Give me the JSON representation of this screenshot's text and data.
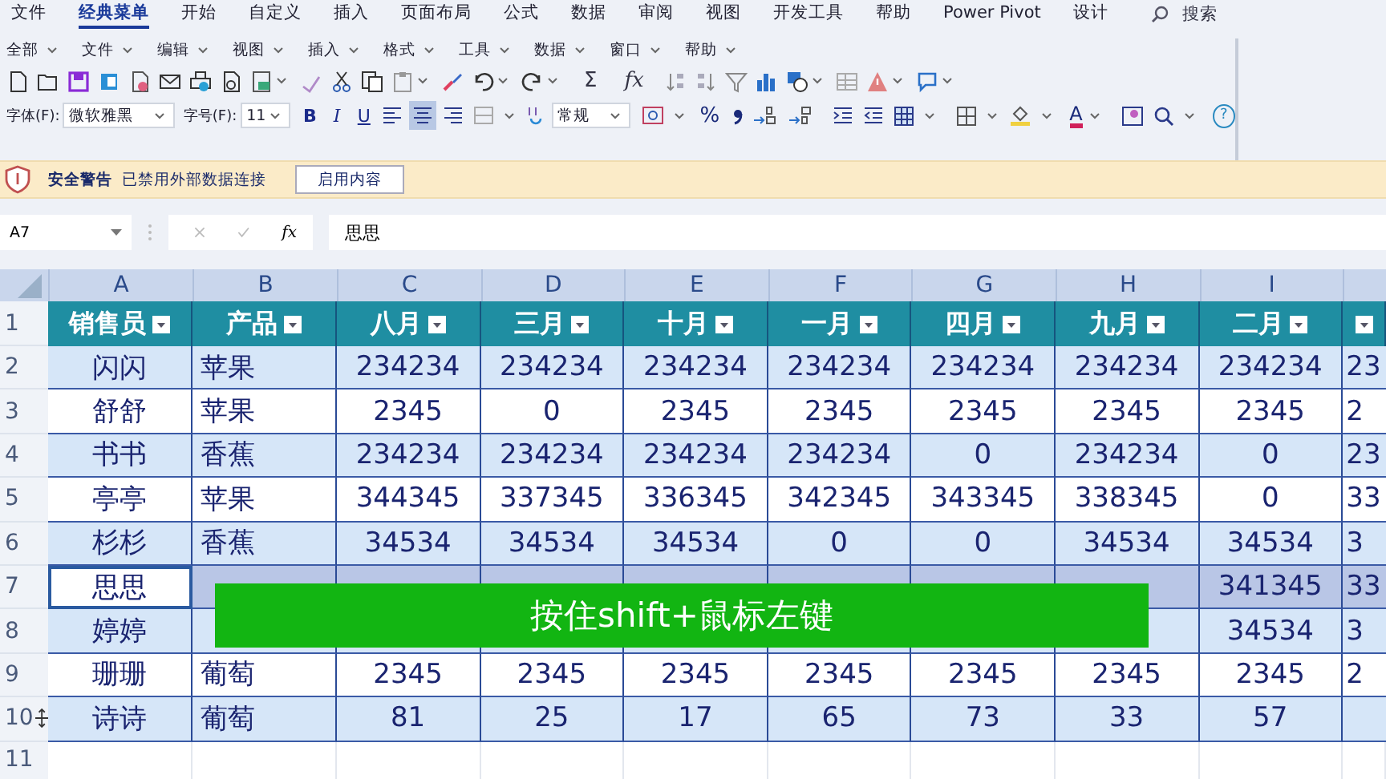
{
  "menu_tabs": [
    {
      "label": "文件",
      "selected": false
    },
    {
      "label": "经典菜单",
      "selected": true
    },
    {
      "label": "开始",
      "selected": false
    },
    {
      "label": "自定义",
      "selected": false
    },
    {
      "label": "插入",
      "selected": false
    },
    {
      "label": "页面布局",
      "selected": false
    },
    {
      "label": "公式",
      "selected": false
    },
    {
      "label": "数据",
      "selected": false
    },
    {
      "label": "审阅",
      "selected": false
    },
    {
      "label": "视图",
      "selected": false
    },
    {
      "label": "开发工具",
      "selected": false
    },
    {
      "label": "帮助",
      "selected": false
    },
    {
      "label": "Power Pivot",
      "selected": false
    },
    {
      "label": "设计",
      "selected": false
    }
  ],
  "search": {
    "label": "搜索"
  },
  "classic_menus": [
    "全部",
    "文件",
    "编辑",
    "视图",
    "插入",
    "格式",
    "工具",
    "数据",
    "窗口",
    "帮助"
  ],
  "toolbar": {
    "sum": "Σ",
    "fx": "fx"
  },
  "format_bar": {
    "font_label": "字体(F):",
    "font": "微软雅黑",
    "size_label": "字号(F):",
    "size": "11",
    "bold": "B",
    "italic": "I",
    "underline": "U",
    "align": [
      {
        "selected": false
      },
      {
        "selected": true
      },
      {
        "selected": false
      }
    ],
    "number_format": "常规",
    "percent": "%",
    "font_color": "A",
    "help": "?"
  },
  "security_bar": {
    "title": "安全警告",
    "message": "已禁用外部数据连接",
    "button": "启用内容"
  },
  "formula_bar": {
    "cell_ref": "A7",
    "fx": "fx",
    "value": "思思"
  },
  "sheet": {
    "columns": [
      "A",
      "B",
      "C",
      "D",
      "E",
      "F",
      "G",
      "H",
      "I"
    ],
    "row_numbers": [
      "1",
      "2",
      "3",
      "4",
      "5",
      "6",
      "7",
      "8",
      "9",
      "10",
      "11"
    ],
    "header": [
      "销售员",
      "产品",
      "八月",
      "三月",
      "十月",
      "一月",
      "四月",
      "九月",
      "二月"
    ],
    "rows": [
      {
        "selected": false,
        "cells": [
          "闪闪",
          "苹果",
          "234234",
          "234234",
          "234234",
          "234234",
          "234234",
          "234234",
          "234234",
          "23"
        ]
      },
      {
        "selected": false,
        "cells": [
          "舒舒",
          "苹果",
          "2345",
          "0",
          "2345",
          "2345",
          "2345",
          "2345",
          "2345",
          "2"
        ]
      },
      {
        "selected": false,
        "cells": [
          "书书",
          "香蕉",
          "234234",
          "234234",
          "234234",
          "234234",
          "0",
          "234234",
          "0",
          "23"
        ]
      },
      {
        "selected": false,
        "cells": [
          "亭亭",
          "苹果",
          "344345",
          "337345",
          "336345",
          "342345",
          "343345",
          "338345",
          "0",
          "33"
        ]
      },
      {
        "selected": false,
        "cells": [
          "杉杉",
          "香蕉",
          "34534",
          "34534",
          "34534",
          "0",
          "0",
          "34534",
          "34534",
          "3"
        ]
      },
      {
        "selected": true,
        "cells": [
          "思思",
          null,
          null,
          null,
          null,
          null,
          null,
          null,
          "341345",
          "33"
        ]
      },
      {
        "selected": false,
        "cells": [
          "婷婷",
          null,
          null,
          null,
          null,
          null,
          null,
          null,
          "34534",
          "3"
        ]
      },
      {
        "selected": false,
        "cells": [
          "珊珊",
          "葡萄",
          "2345",
          "2345",
          "2345",
          "2345",
          "2345",
          "2345",
          "2345",
          "2"
        ]
      },
      {
        "selected": false,
        "cells": [
          "诗诗",
          "葡萄",
          "81",
          "25",
          "17",
          "65",
          "73",
          "33",
          "57",
          null
        ]
      }
    ]
  },
  "caption": "按住shift+鼠标左键"
}
